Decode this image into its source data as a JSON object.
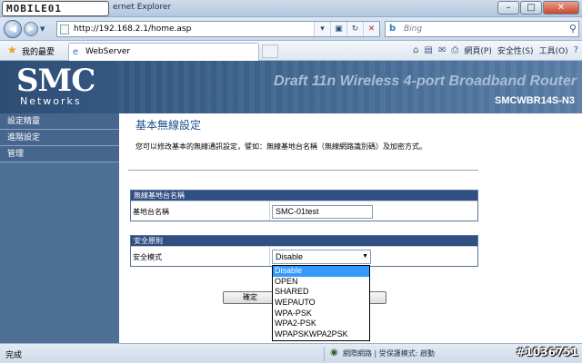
{
  "browser": {
    "watermark_logo": "MOBILE01",
    "window_title": "ernet Explorer",
    "url": "http://192.168.2.1/home.asp",
    "search_placeholder": "Bing",
    "favorites_label": "我的最愛",
    "tab_label": "WebServer",
    "commands": [
      "網頁(P)",
      "安全性(S)",
      "工具(O)"
    ],
    "status": "完成",
    "zone": "網際網路 | 受保護模式: 啟動",
    "watermark_id": "#1036751"
  },
  "header": {
    "logo": "SMC",
    "logo_sub": "Networks",
    "product_title": "Draft 11n Wireless 4-port Broadband Router",
    "model": "SMCWBR14S-N3"
  },
  "sidebar": {
    "items": [
      {
        "label": "設定精靈"
      },
      {
        "label": "進階設定"
      },
      {
        "label": "管理"
      }
    ]
  },
  "content": {
    "title": "基本無線設定",
    "description": "您可以修改基本的無線通訊設定，譬如：無線基地台名稱（無線網路識別碼）及加密方式。",
    "ssid_section": {
      "header": "無線基地台名稱",
      "label": "基地台名稱",
      "value": "SMC-01test"
    },
    "security_section": {
      "header": "安全原則",
      "label": "安全模式",
      "selected": "Disable",
      "options": [
        "Disable",
        "OPEN",
        "SHARED",
        "WEPAUTO",
        "WPA-PSK",
        "WPA2-PSK",
        "WPAPSKWPA2PSK"
      ]
    },
    "apply_label": "確定"
  }
}
